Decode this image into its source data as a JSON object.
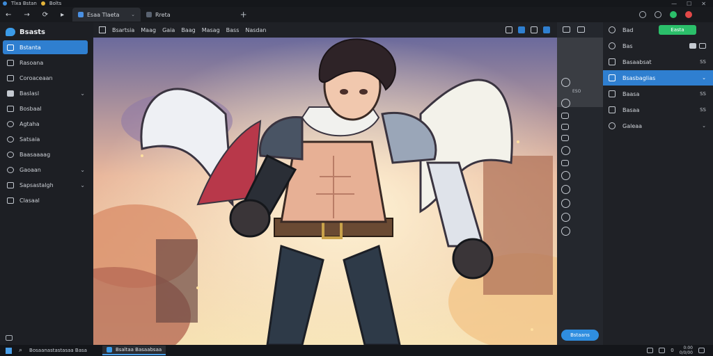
{
  "window": {
    "title": "Tlxa Bstan",
    "tab2_title": "Bolts",
    "controls": [
      "—",
      "☐",
      "✕"
    ]
  },
  "nav": {
    "back": "←",
    "forward": "→",
    "refresh": "⟳",
    "bookmark": "▸"
  },
  "tabs": [
    {
      "label": "Esaa Tlaeta",
      "close": "⌄",
      "active": true
    },
    {
      "label": "Rreta",
      "active": false
    }
  ],
  "newtab": "+",
  "sidebar": {
    "brand": "Bsasts",
    "items": [
      {
        "label": "Bstanta",
        "icon": "panel-icon",
        "active": true
      },
      {
        "label": "Rasoana",
        "icon": "chat-icon"
      },
      {
        "label": "Coroaceaan",
        "icon": "screen-icon"
      },
      {
        "label": "Baslasl",
        "icon": "folder-icon",
        "chevron": "⌄"
      },
      {
        "label": "Bosbaal",
        "icon": "window-icon"
      },
      {
        "label": "Agtaha",
        "icon": "globe-icon"
      },
      {
        "label": "Satsaia",
        "icon": "settings-icon"
      },
      {
        "label": "Baasaaaag",
        "icon": "gear-icon"
      },
      {
        "label": "Gaoaan",
        "icon": "key-icon",
        "chevron": "⌄"
      },
      {
        "label": "Sapsastalgh",
        "icon": "pen-icon",
        "chevron": "⌄"
      },
      {
        "label": "Clasaal",
        "icon": "puzzle-icon"
      }
    ]
  },
  "toolbar": {
    "menus": [
      "Bsartsia",
      "Maag",
      "Gaia",
      "Baag",
      "Masag",
      "Bass",
      "Nasdan"
    ]
  },
  "vstrip": {
    "label": "ESO",
    "apply": "Bstaans"
  },
  "rpanel": {
    "items": [
      {
        "label": "Bad",
        "icon": "search-icon",
        "button": "Easta"
      },
      {
        "label": "Bas",
        "icon": "refresh-icon"
      },
      {
        "label": "Basaabsat",
        "icon": "document-icon",
        "side": "SS"
      },
      {
        "label": "Bsasbaglias",
        "icon": "layers-icon",
        "side": "⌄",
        "active": true
      },
      {
        "label": "Baasa",
        "icon": "square-icon",
        "side": "SS"
      },
      {
        "label": "Basaa",
        "icon": "image-icon",
        "side": "SS"
      },
      {
        "label": "Galeaa",
        "icon": "tools-icon",
        "side": "⌄"
      }
    ]
  },
  "taskbar": {
    "search_text": "Bosaanastastasaa Basa",
    "app_label": "Bsaltaa Basaabsaa",
    "tray_num": "0",
    "time": "0:00",
    "date": "0/0/00"
  }
}
